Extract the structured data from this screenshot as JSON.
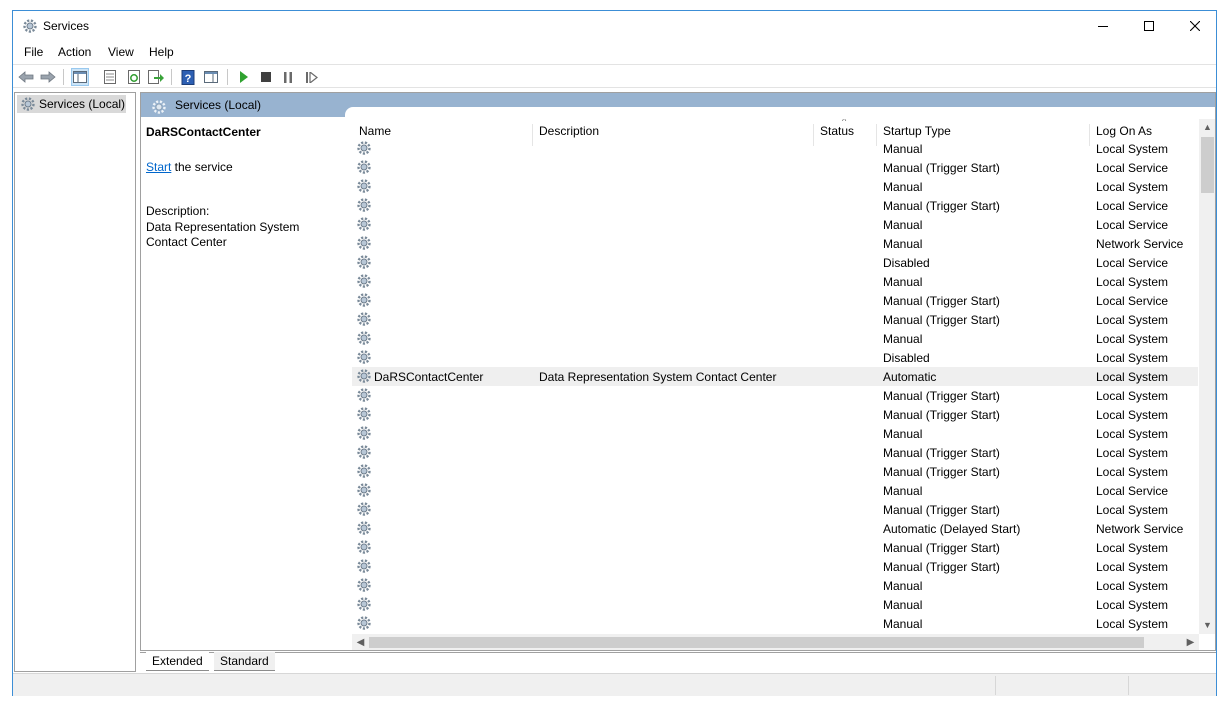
{
  "window": {
    "title": "Services"
  },
  "menu": [
    "File",
    "Action",
    "View",
    "Help"
  ],
  "tree": {
    "item": "Services (Local)"
  },
  "panel": {
    "header": "Services (Local)"
  },
  "details": {
    "service_name": "DaRSContactCenter",
    "action_link": "Start",
    "action_rest": " the service",
    "description_label": "Description:",
    "description_text": "Data Representation System Contact Center"
  },
  "columns": {
    "name": "Name",
    "description": "Description",
    "status": "Status",
    "startup": "Startup Type",
    "logon": "Log On As"
  },
  "services": [
    {
      "name": "",
      "description": "",
      "status": "",
      "startup": "Manual",
      "logon": "Local System"
    },
    {
      "name": "",
      "description": "",
      "status": "",
      "startup": "Manual (Trigger Start)",
      "logon": "Local Service"
    },
    {
      "name": "",
      "description": "",
      "status": "",
      "startup": "Manual",
      "logon": "Local System"
    },
    {
      "name": "",
      "description": "",
      "status": "",
      "startup": "Manual (Trigger Start)",
      "logon": "Local Service"
    },
    {
      "name": "",
      "description": "",
      "status": "",
      "startup": "Manual",
      "logon": "Local Service"
    },
    {
      "name": "",
      "description": "",
      "status": "",
      "startup": "Manual",
      "logon": "Network Service"
    },
    {
      "name": "",
      "description": "",
      "status": "",
      "startup": "Disabled",
      "logon": "Local Service"
    },
    {
      "name": "",
      "description": "",
      "status": "",
      "startup": "Manual",
      "logon": "Local System"
    },
    {
      "name": "",
      "description": "",
      "status": "",
      "startup": "Manual (Trigger Start)",
      "logon": "Local Service"
    },
    {
      "name": "",
      "description": "",
      "status": "",
      "startup": "Manual (Trigger Start)",
      "logon": "Local System"
    },
    {
      "name": "",
      "description": "",
      "status": "",
      "startup": "Manual",
      "logon": "Local System"
    },
    {
      "name": "",
      "description": "",
      "status": "",
      "startup": "Disabled",
      "logon": "Local System"
    },
    {
      "name": "DaRSContactCenter",
      "description": "Data Representation System Contact Center",
      "status": "",
      "startup": "Automatic",
      "logon": "Local System",
      "selected": true
    },
    {
      "name": "",
      "description": "",
      "status": "",
      "startup": "Manual (Trigger Start)",
      "logon": "Local System"
    },
    {
      "name": "",
      "description": "",
      "status": "",
      "startup": "Manual (Trigger Start)",
      "logon": "Local System"
    },
    {
      "name": "",
      "description": "",
      "status": "",
      "startup": "Manual",
      "logon": "Local System"
    },
    {
      "name": "",
      "description": "",
      "status": "",
      "startup": "Manual (Trigger Start)",
      "logon": "Local System"
    },
    {
      "name": "",
      "description": "",
      "status": "",
      "startup": "Manual (Trigger Start)",
      "logon": "Local System"
    },
    {
      "name": "",
      "description": "",
      "status": "",
      "startup": "Manual",
      "logon": "Local Service"
    },
    {
      "name": "",
      "description": "",
      "status": "",
      "startup": "Manual (Trigger Start)",
      "logon": "Local System"
    },
    {
      "name": "",
      "description": "",
      "status": "",
      "startup": "Automatic (Delayed Start)",
      "logon": "Network Service"
    },
    {
      "name": "",
      "description": "",
      "status": "",
      "startup": "Manual (Trigger Start)",
      "logon": "Local System"
    },
    {
      "name": "",
      "description": "",
      "status": "",
      "startup": "Manual (Trigger Start)",
      "logon": "Local System"
    },
    {
      "name": "",
      "description": "",
      "status": "",
      "startup": "Manual",
      "logon": "Local System"
    },
    {
      "name": "",
      "description": "",
      "status": "",
      "startup": "Manual",
      "logon": "Local System"
    },
    {
      "name": "",
      "description": "",
      "status": "",
      "startup": "Manual",
      "logon": "Local System"
    }
  ],
  "tabs": {
    "extended": "Extended",
    "standard": "Standard"
  },
  "colors": {
    "header_band": "#98b3d0",
    "selection": "#efefef",
    "link": "#0066cc",
    "play": "#2fa22f"
  }
}
